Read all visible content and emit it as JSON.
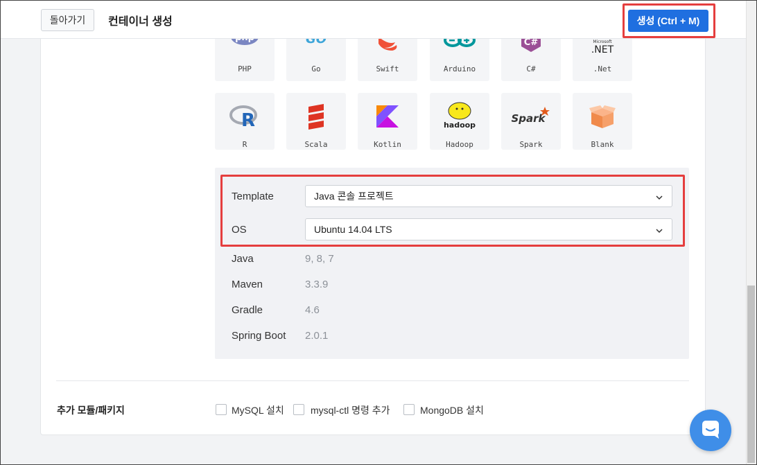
{
  "header": {
    "back_label": "돌아가기",
    "title": "컨테이너 생성",
    "create_label": "생성 (Ctrl + M)"
  },
  "languages_row1": [
    {
      "label": "PHP",
      "icon": "php-icon"
    },
    {
      "label": "Go",
      "icon": "go-icon"
    },
    {
      "label": "Swift",
      "icon": "swift-icon"
    },
    {
      "label": "Arduino",
      "icon": "arduino-icon"
    },
    {
      "label": "C#",
      "icon": "csharp-icon"
    },
    {
      "label": ".Net",
      "icon": "dotnet-icon"
    }
  ],
  "languages_row2": [
    {
      "label": "R",
      "icon": "r-icon"
    },
    {
      "label": "Scala",
      "icon": "scala-icon"
    },
    {
      "label": "Kotlin",
      "icon": "kotlin-icon"
    },
    {
      "label": "Hadoop",
      "icon": "hadoop-icon"
    },
    {
      "label": "Spark",
      "icon": "spark-icon"
    },
    {
      "label": "Blank",
      "icon": "blank-box-icon"
    }
  ],
  "logo_text": {
    "php": "php",
    "go": "GO",
    "net": ".NET",
    "ms": "Microsoft",
    "hadoop": "hadoop",
    "spark": "Spark"
  },
  "settings": {
    "template_label": "Template",
    "template_value": "Java 콘솔 프로젝트",
    "os_label": "OS",
    "os_value": "Ubuntu 14.04 LTS"
  },
  "versions": [
    {
      "name": "Java",
      "value": "9, 8, 7"
    },
    {
      "name": "Maven",
      "value": "3.3.9"
    },
    {
      "name": "Gradle",
      "value": "4.6"
    },
    {
      "name": "Spring Boot",
      "value": "2.0.1"
    }
  ],
  "addons": {
    "title": "추가 모듈/패키지",
    "options": [
      {
        "label": "MySQL 설치",
        "checked": false
      },
      {
        "label": "mysql-ctl 명령 추가",
        "checked": false
      },
      {
        "label": "MongoDB 설치",
        "checked": false
      }
    ]
  },
  "colors": {
    "accent": "#1f6fe0",
    "highlight": "#e53e3e",
    "chat": "#3f8ee8"
  }
}
